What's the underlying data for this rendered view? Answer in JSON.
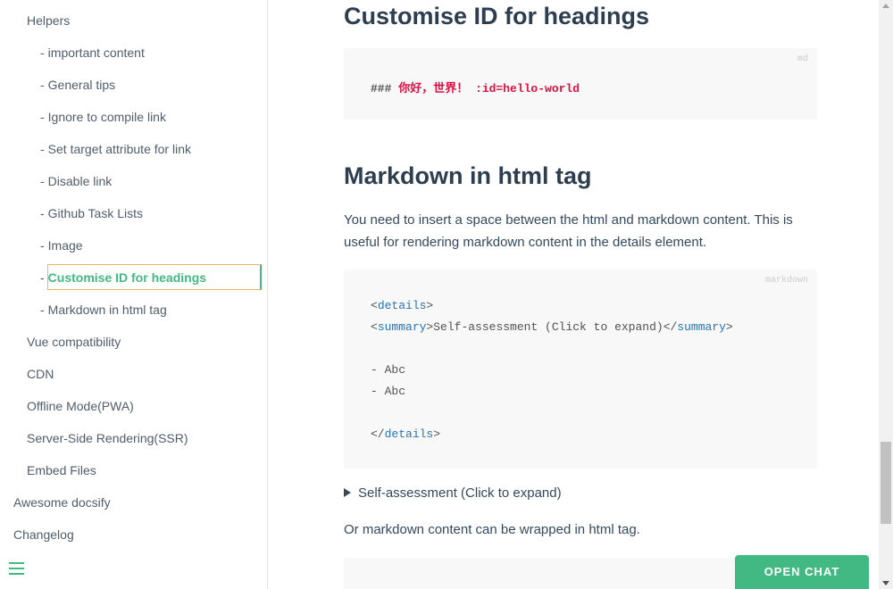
{
  "sidebar": {
    "items": [
      {
        "label": "Helpers",
        "level": 1
      },
      {
        "label": "important content",
        "level": 2
      },
      {
        "label": "General tips",
        "level": 2
      },
      {
        "label": "Ignore to compile link",
        "level": 2
      },
      {
        "label": "Set target attribute for link",
        "level": 2
      },
      {
        "label": "Disable link",
        "level": 2
      },
      {
        "label": "Github Task Lists",
        "level": 2
      },
      {
        "label": "Image",
        "level": 2
      },
      {
        "label": "Customise ID for headings",
        "level": 2,
        "active": true
      },
      {
        "label": "Markdown in html tag",
        "level": 2
      },
      {
        "label": "Vue compatibility",
        "level": 1
      },
      {
        "label": "CDN",
        "level": 1
      },
      {
        "label": "Offline Mode(PWA)",
        "level": 1
      },
      {
        "label": "Server-Side Rendering(SSR)",
        "level": 1
      },
      {
        "label": "Embed Files",
        "level": 1
      },
      {
        "label": "Awesome docsify",
        "level": 0
      },
      {
        "label": "Changelog",
        "level": 0
      }
    ],
    "dash": "-",
    "menu_icon": "hamburger-icon"
  },
  "main": {
    "section1_title": "Customise ID for headings",
    "code1": {
      "lang": "md",
      "prefix": "###",
      "text": "你好，世界！ :id=hello-world"
    },
    "section2_title": "Markdown in html tag",
    "intro_text": "You need to insert a space between the html and markdown content. This is useful for rendering markdown content in the details element.",
    "code2": {
      "lang": "markdown",
      "lt": "<",
      "gt": ">",
      "close_lt": "</",
      "details_tag": "details",
      "summary_tag": "summary",
      "summary_text": "Self-assessment (Click to expand)",
      "list_item_1": "- Abc",
      "list_item_2": "- Abc"
    },
    "details_summary": "Self-assessment (Click to expand)",
    "outro_text": "Or markdown content can be wrapped in html tag."
  },
  "chat": {
    "label": "OPEN CHAT"
  },
  "colors": {
    "accent": "#42b983",
    "text": "#34495e",
    "heading": "#2c3e50",
    "tag": "#2973b7"
  }
}
